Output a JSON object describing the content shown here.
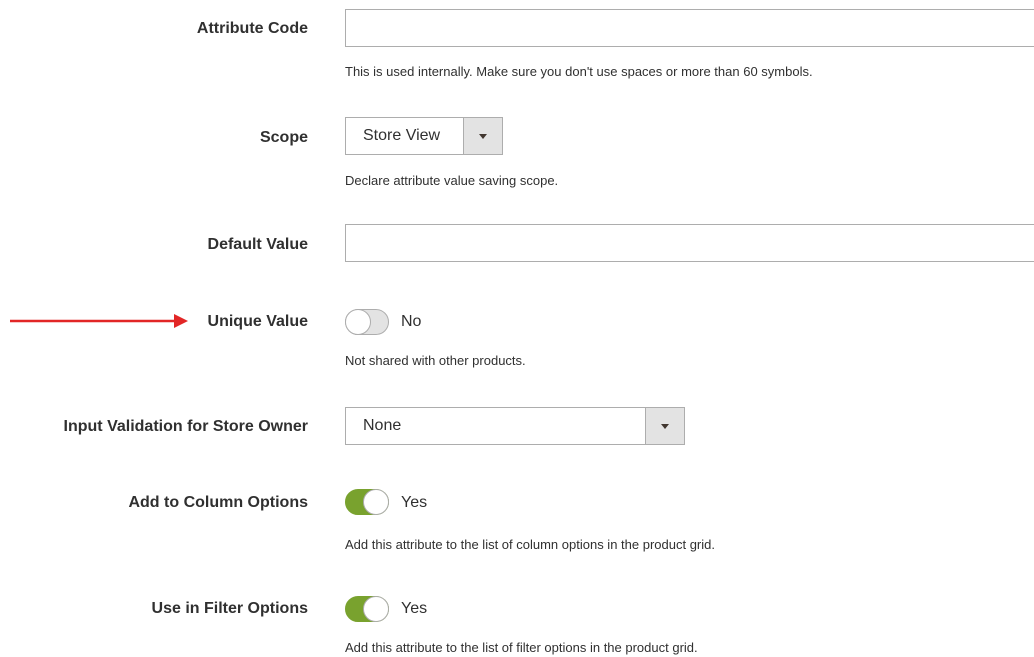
{
  "colors": {
    "toggle_on": "#79a22e",
    "arrow": "#e22626"
  },
  "fields": {
    "attribute_code": {
      "label": "Attribute Code",
      "value": "",
      "note": "This is used internally. Make sure you don't use spaces or more than 60 symbols."
    },
    "scope": {
      "label": "Scope",
      "value": "Store View",
      "note": "Declare attribute value saving scope."
    },
    "default_value": {
      "label": "Default Value",
      "value": ""
    },
    "unique_value": {
      "label": "Unique Value",
      "state": "No",
      "note": "Not shared with other products."
    },
    "input_validation": {
      "label": "Input Validation for Store Owner",
      "value": "None"
    },
    "add_to_column_options": {
      "label": "Add to Column Options",
      "state": "Yes",
      "note": "Add this attribute to the list of column options in the product grid."
    },
    "use_in_filter_options": {
      "label": "Use in Filter Options",
      "state": "Yes",
      "note": "Add this attribute to the list of filter options in the product grid."
    }
  }
}
